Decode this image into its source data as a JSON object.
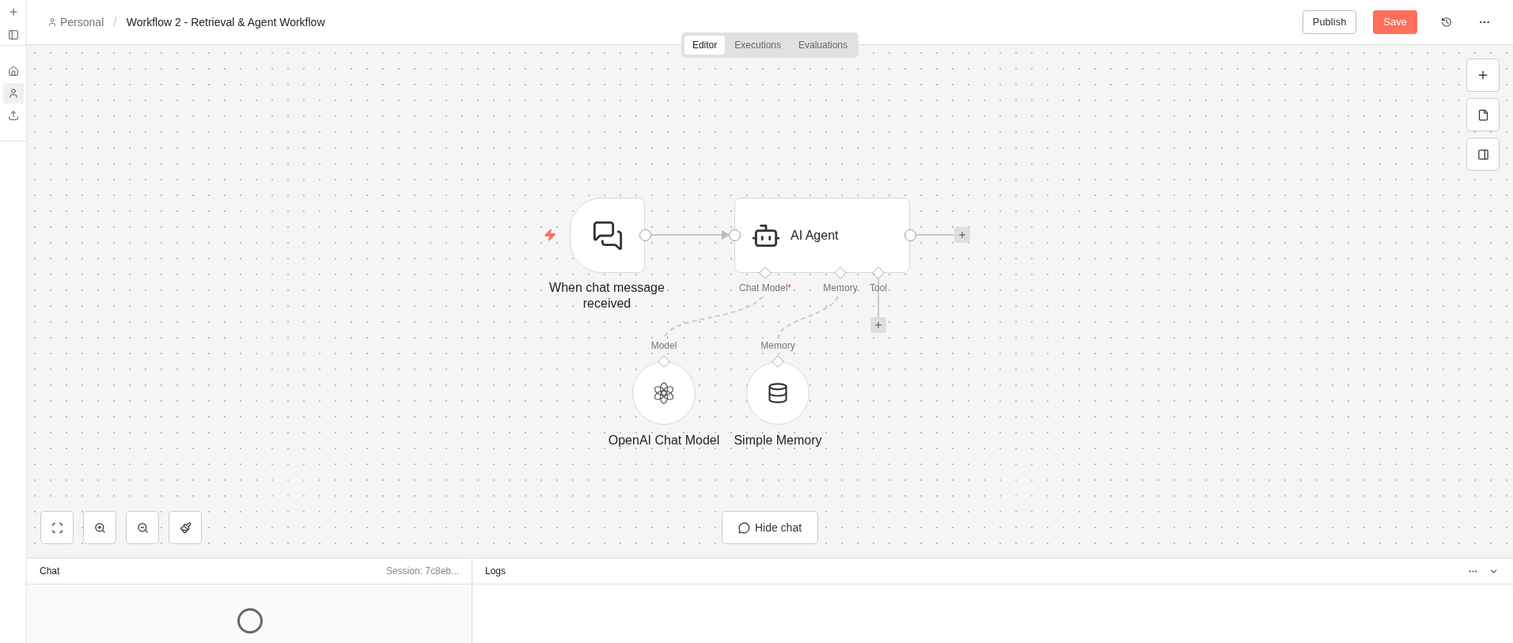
{
  "sidebar": {
    "items": [
      {
        "kind": "add",
        "selected": false
      },
      {
        "kind": "panel",
        "selected": false
      },
      {
        "kind": "home",
        "selected": false
      },
      {
        "kind": "person",
        "selected": true
      },
      {
        "kind": "share",
        "selected": false
      }
    ]
  },
  "breadcrumb": {
    "project": "Personal",
    "separator": "/",
    "workflow": "Workflow 2 - Retrieval & Agent Workflow"
  },
  "header_actions": {
    "publish": "Publish",
    "save": "Save"
  },
  "tabs": [
    {
      "label": "Editor",
      "selected": true
    },
    {
      "label": "Executions",
      "selected": false
    },
    {
      "label": "Evaluations",
      "selected": false
    }
  ],
  "nodes": [
    {
      "kind": "trigger",
      "label": "When chat message received"
    },
    {
      "kind": "agent",
      "label": "AI Agent",
      "inputs": [
        {
          "label": "Chat Model",
          "required_mark": "*"
        },
        {
          "label": "Memory"
        },
        {
          "label": "Tool"
        }
      ]
    },
    {
      "kind": "model",
      "label": "OpenAI Chat Model",
      "port": "Model"
    },
    {
      "kind": "memory",
      "label": "Simple Memory",
      "port": "Memory"
    }
  ],
  "hide_chat": "Hide chat",
  "chat_panel": {
    "title": "Chat",
    "session": "Session: 7c8eb..."
  },
  "logs_panel": {
    "title": "Logs"
  }
}
